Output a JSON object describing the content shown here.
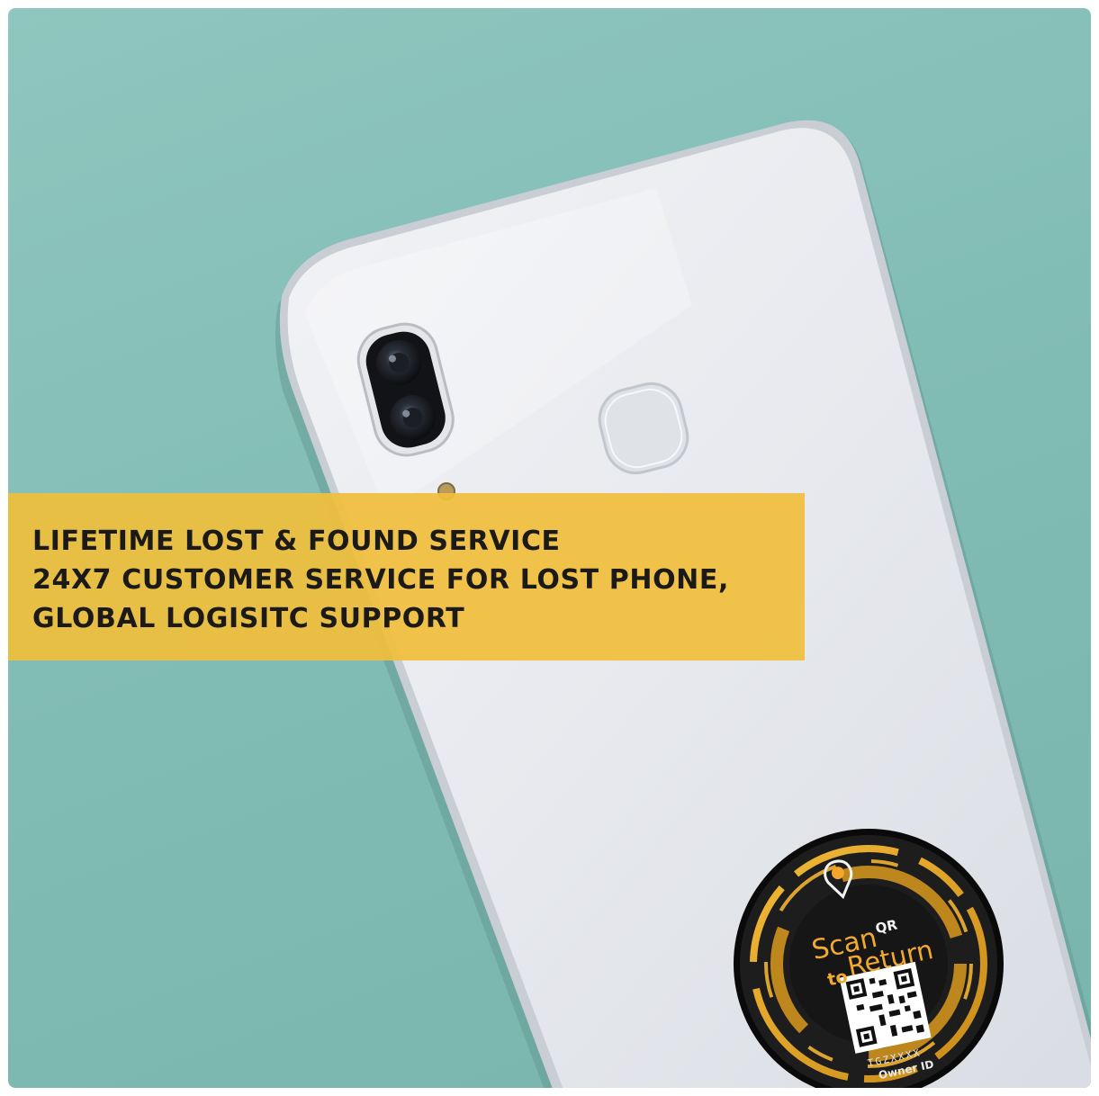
{
  "banner": {
    "lines": [
      "LIFETIME LOST & FOUND SERVICE",
      "24X7 CUSTOMER SERVICE FOR LOST PHONE,",
      "GLOBAL LOGISITC SUPPORT"
    ]
  },
  "sticker": {
    "scan": "Scan",
    "qr": "QR",
    "to": "to",
    "return": "Return",
    "code": "TGZXXXX",
    "owner": "Owner ID"
  },
  "colors": {
    "background": "#86c0b8",
    "banner": "#f0be3c",
    "phone_body": "#e9ebef",
    "sticker_accent": "#f2b431",
    "sticker_base": "#121212"
  },
  "icons": [
    "location-pin-icon",
    "qr-code-icon"
  ]
}
